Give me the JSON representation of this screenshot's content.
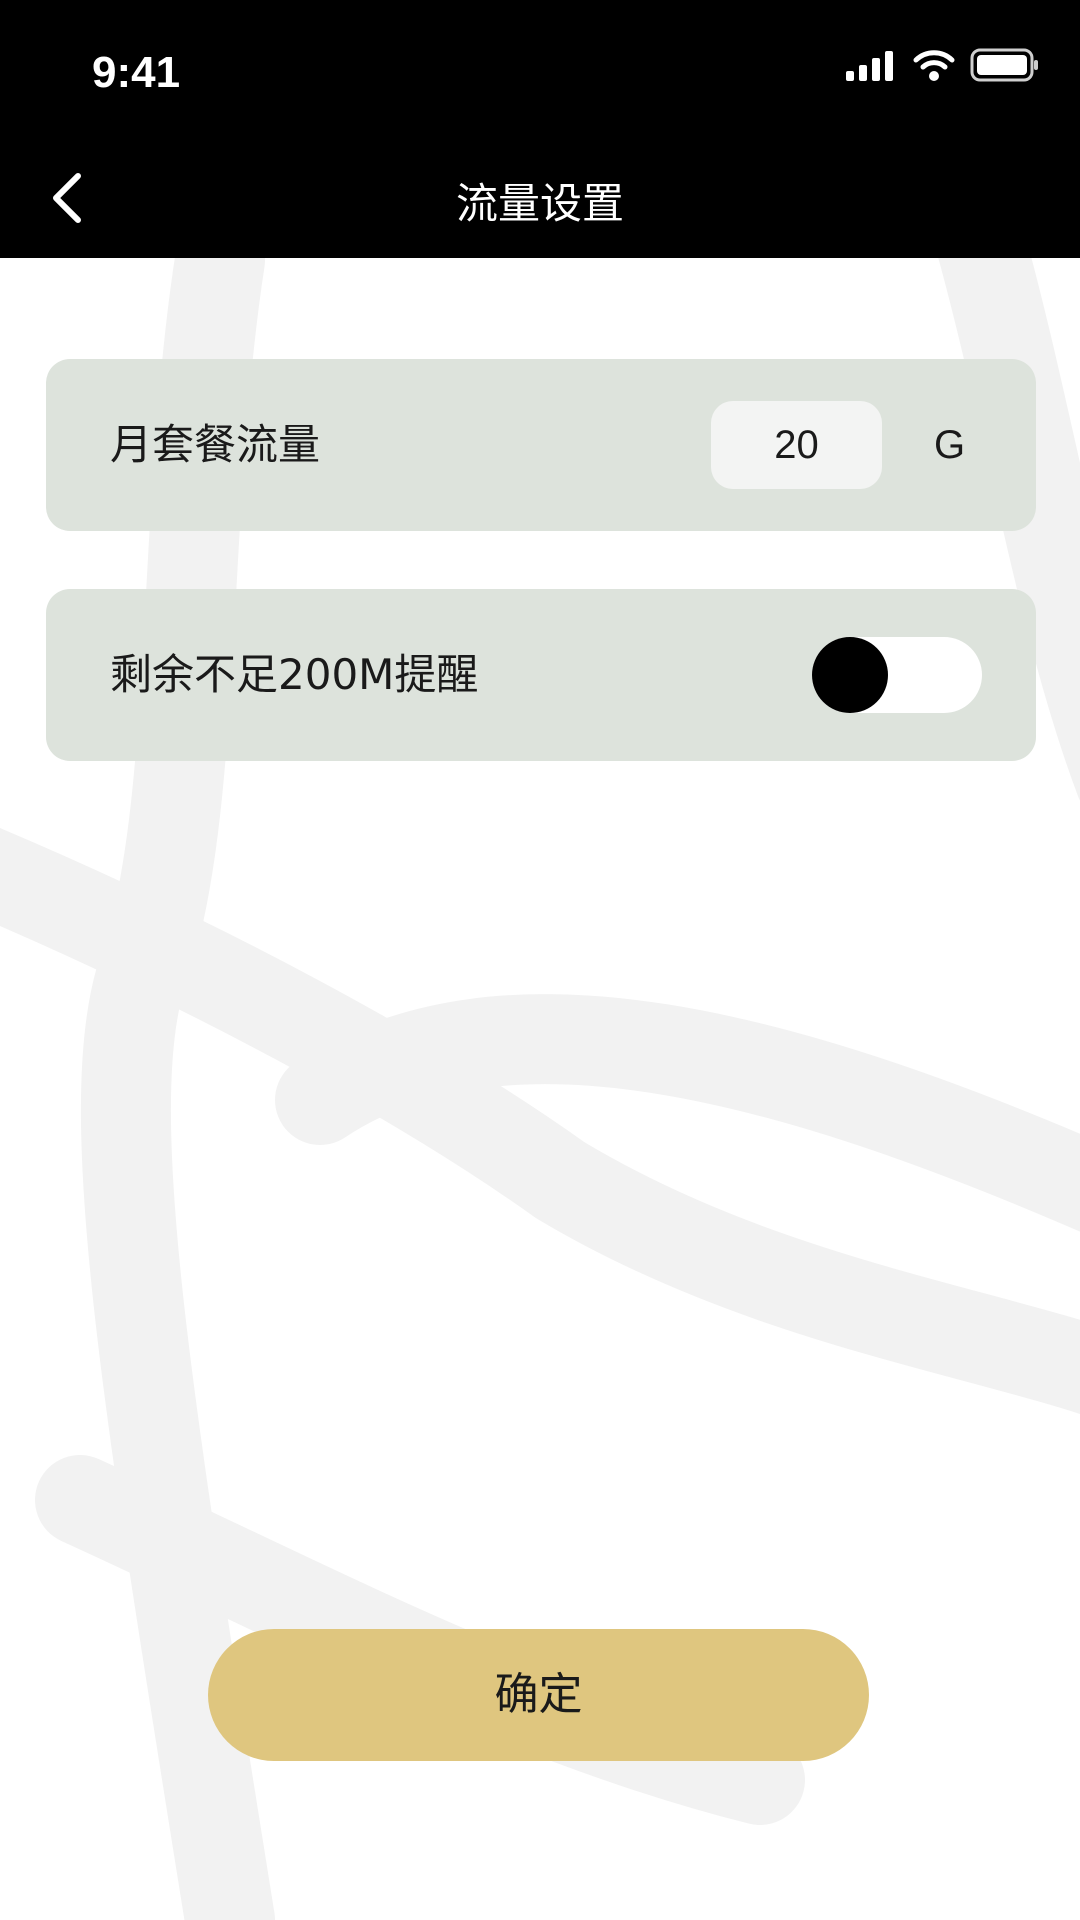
{
  "status_bar": {
    "time": "9:41"
  },
  "header": {
    "title": "流量设置",
    "back_icon": "chevron-left-icon"
  },
  "settings": {
    "monthly_plan": {
      "label": "月套餐流量",
      "value": "20",
      "unit": "G"
    },
    "low_data_alert": {
      "label": "剩余不足200M提醒",
      "enabled": false
    }
  },
  "actions": {
    "confirm_label": "确定"
  },
  "colors": {
    "header_bg": "#000000",
    "card_bg": "#dde3dc",
    "button_bg": "#dfc67f"
  }
}
